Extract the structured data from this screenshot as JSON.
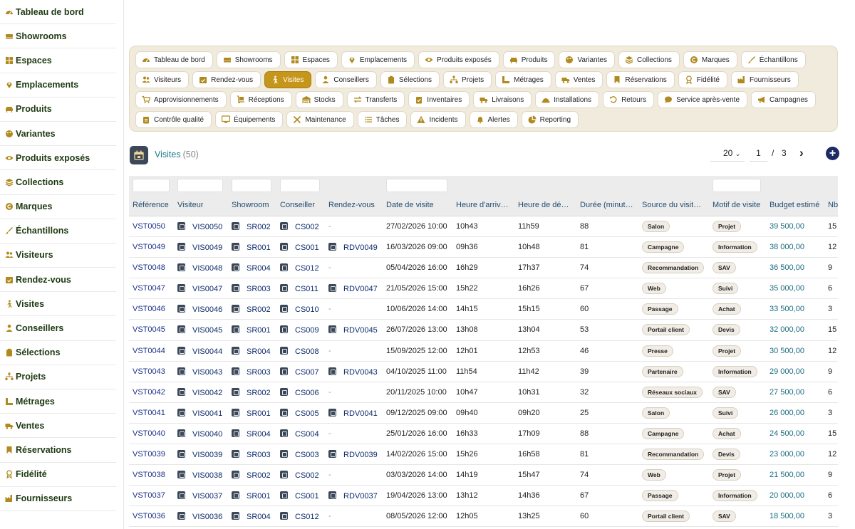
{
  "sidebar": [
    {
      "label": "Tableau de bord",
      "icon": "dashboard-icon"
    },
    {
      "label": "Showrooms",
      "icon": "showroom-icon"
    },
    {
      "label": "Espaces",
      "icon": "grid-icon"
    },
    {
      "label": "Emplacements",
      "icon": "location-pin-icon"
    },
    {
      "label": "Produits",
      "icon": "couch-icon"
    },
    {
      "label": "Variantes",
      "icon": "palette-icon"
    },
    {
      "label": "Produits exposés",
      "icon": "eye-icon"
    },
    {
      "label": "Collections",
      "icon": "layers-icon"
    },
    {
      "label": "Marques",
      "icon": "copyright-icon"
    },
    {
      "label": "Échantillons",
      "icon": "brush-icon"
    },
    {
      "label": "Visiteurs",
      "icon": "users-icon"
    },
    {
      "label": "Rendez-vous",
      "icon": "calendar-check-icon"
    },
    {
      "label": "Visites",
      "icon": "walking-icon"
    },
    {
      "label": "Conseillers",
      "icon": "user-tie-icon"
    },
    {
      "label": "Sélections",
      "icon": "clipboard-icon"
    },
    {
      "label": "Projets",
      "icon": "sitemap-icon"
    },
    {
      "label": "Métrages",
      "icon": "ruler-icon"
    },
    {
      "label": "Ventes",
      "icon": "truck-icon"
    },
    {
      "label": "Réservations",
      "icon": "bookmark-icon"
    },
    {
      "label": "Fidélité",
      "icon": "award-icon"
    },
    {
      "label": "Fournisseurs",
      "icon": "factory-icon"
    }
  ],
  "chips": [
    {
      "label": "Tableau de bord",
      "icon": "dashboard-icon",
      "active": false
    },
    {
      "label": "Showrooms",
      "icon": "showroom-icon",
      "active": false
    },
    {
      "label": "Espaces",
      "icon": "grid-icon",
      "active": false
    },
    {
      "label": "Emplacements",
      "icon": "location-pin-icon",
      "active": false
    },
    {
      "label": "Produits exposés",
      "icon": "eye-icon",
      "active": false
    },
    {
      "label": "Produits",
      "icon": "couch-icon",
      "active": false
    },
    {
      "label": "Variantes",
      "icon": "palette-icon",
      "active": false
    },
    {
      "label": "Collections",
      "icon": "layers-icon",
      "active": false
    },
    {
      "label": "Marques",
      "icon": "copyright-icon",
      "active": false
    },
    {
      "label": "Échantillons",
      "icon": "brush-icon",
      "active": false
    },
    {
      "label": "Visiteurs",
      "icon": "users-icon",
      "active": false
    },
    {
      "label": "Rendez-vous",
      "icon": "calendar-check-icon",
      "active": false
    },
    {
      "label": "Visites",
      "icon": "walking-icon",
      "active": true
    },
    {
      "label": "Conseillers",
      "icon": "user-tie-icon",
      "active": false
    },
    {
      "label": "Sélections",
      "icon": "clipboard-icon",
      "active": false
    },
    {
      "label": "Projets",
      "icon": "sitemap-icon",
      "active": false
    },
    {
      "label": "Métrages",
      "icon": "ruler-icon",
      "active": false
    },
    {
      "label": "Ventes",
      "icon": "truck-icon",
      "active": false
    },
    {
      "label": "Réservations",
      "icon": "bookmark-icon",
      "active": false
    },
    {
      "label": "Fidélité",
      "icon": "award-icon",
      "active": false
    },
    {
      "label": "Fournisseurs",
      "icon": "factory-icon",
      "active": false
    },
    {
      "label": "Approvisionnements",
      "icon": "cart-icon",
      "active": false
    },
    {
      "label": "Réceptions",
      "icon": "dolly-icon",
      "active": false
    },
    {
      "label": "Stocks",
      "icon": "warehouse-icon",
      "active": false
    },
    {
      "label": "Transferts",
      "icon": "exchange-icon",
      "active": false
    },
    {
      "label": "Inventaires",
      "icon": "clipboard-check-icon",
      "active": false
    },
    {
      "label": "Livraisons",
      "icon": "shipping-icon",
      "active": false
    },
    {
      "label": "Installations",
      "icon": "hardhat-icon",
      "active": false
    },
    {
      "label": "Retours",
      "icon": "undo-icon",
      "active": false
    },
    {
      "label": "Service après-vente",
      "icon": "comment-icon",
      "active": false
    },
    {
      "label": "Campagnes",
      "icon": "megaphone-icon",
      "active": false
    },
    {
      "label": "Contrôle qualité",
      "icon": "clipboard-list-icon",
      "active": false
    },
    {
      "label": "Équipements",
      "icon": "desktop-icon",
      "active": false
    },
    {
      "label": "Maintenance",
      "icon": "tools-icon",
      "active": false
    },
    {
      "label": "Tâches",
      "icon": "list-icon",
      "active": false
    },
    {
      "label": "Incidents",
      "icon": "warning-icon",
      "active": false
    },
    {
      "label": "Alertes",
      "icon": "bell-icon",
      "active": false
    },
    {
      "label": "Reporting",
      "icon": "pie-chart-icon",
      "active": false
    }
  ],
  "header": {
    "title": "Visites",
    "count": "(50)"
  },
  "pagination": {
    "page_size": "20",
    "page": "1",
    "separator": "/",
    "total_pages": "3"
  },
  "columns": [
    "Référence",
    "Visiteur",
    "Showroom",
    "Conseiller",
    "Rendez-vous",
    "Date de visite",
    "Heure d'arriv…",
    "Heure de dé…",
    "Durée (minut…",
    "Source du visit…",
    "Motif de visite",
    "Budget estimé",
    "Nb"
  ],
  "rows": [
    {
      "ref": "VST0050",
      "visiteur": "VIS0050",
      "showroom": "SR002",
      "conseiller": "CS002",
      "rdv": "-",
      "date": "27/02/2026 10:00",
      "arrivee": "10h43",
      "depart": "11h59",
      "duree": "88",
      "source": "Salon",
      "motif": "Projet",
      "budget": "39 500,00",
      "nb": "15"
    },
    {
      "ref": "VST0049",
      "visiteur": "VIS0049",
      "showroom": "SR001",
      "conseiller": "CS001",
      "rdv": "RDV0049",
      "date": "16/03/2026 09:00",
      "arrivee": "09h36",
      "depart": "10h48",
      "duree": "81",
      "source": "Campagne",
      "motif": "Information",
      "budget": "38 000,00",
      "nb": "12"
    },
    {
      "ref": "VST0048",
      "visiteur": "VIS0048",
      "showroom": "SR004",
      "conseiller": "CS012",
      "rdv": "-",
      "date": "05/04/2026 16:00",
      "arrivee": "16h29",
      "depart": "17h37",
      "duree": "74",
      "source": "Recommandation",
      "motif": "SAV",
      "budget": "36 500,00",
      "nb": "9"
    },
    {
      "ref": "VST0047",
      "visiteur": "VIS0047",
      "showroom": "SR003",
      "conseiller": "CS011",
      "rdv": "RDV0047",
      "date": "21/05/2026 15:00",
      "arrivee": "15h22",
      "depart": "16h26",
      "duree": "67",
      "source": "Web",
      "motif": "Suivi",
      "budget": "35 000,00",
      "nb": "6"
    },
    {
      "ref": "VST0046",
      "visiteur": "VIS0046",
      "showroom": "SR002",
      "conseiller": "CS010",
      "rdv": "-",
      "date": "10/06/2026 14:00",
      "arrivee": "14h15",
      "depart": "15h15",
      "duree": "60",
      "source": "Passage",
      "motif": "Achat",
      "budget": "33 500,00",
      "nb": "3"
    },
    {
      "ref": "VST0045",
      "visiteur": "VIS0045",
      "showroom": "SR001",
      "conseiller": "CS009",
      "rdv": "RDV0045",
      "date": "26/07/2026 13:00",
      "arrivee": "13h08",
      "depart": "13h04",
      "duree": "53",
      "source": "Portail client",
      "motif": "Devis",
      "budget": "32 000,00",
      "nb": "15"
    },
    {
      "ref": "VST0044",
      "visiteur": "VIS0044",
      "showroom": "SR004",
      "conseiller": "CS008",
      "rdv": "-",
      "date": "15/09/2025 12:00",
      "arrivee": "12h01",
      "depart": "12h53",
      "duree": "46",
      "source": "Presse",
      "motif": "Projet",
      "budget": "30 500,00",
      "nb": "12"
    },
    {
      "ref": "VST0043",
      "visiteur": "VIS0043",
      "showroom": "SR003",
      "conseiller": "CS007",
      "rdv": "RDV0043",
      "date": "04/10/2025 11:00",
      "arrivee": "11h54",
      "depart": "11h42",
      "duree": "39",
      "source": "Partenaire",
      "motif": "Information",
      "budget": "29 000,00",
      "nb": "9"
    },
    {
      "ref": "VST0042",
      "visiteur": "VIS0042",
      "showroom": "SR002",
      "conseiller": "CS006",
      "rdv": "-",
      "date": "20/11/2025 10:00",
      "arrivee": "10h47",
      "depart": "10h31",
      "duree": "32",
      "source": "Réseaux sociaux",
      "motif": "SAV",
      "budget": "27 500,00",
      "nb": "6"
    },
    {
      "ref": "VST0041",
      "visiteur": "VIS0041",
      "showroom": "SR001",
      "conseiller": "CS005",
      "rdv": "RDV0041",
      "date": "09/12/2025 09:00",
      "arrivee": "09h40",
      "depart": "09h20",
      "duree": "25",
      "source": "Salon",
      "motif": "Suivi",
      "budget": "26 000,00",
      "nb": "3"
    },
    {
      "ref": "VST0040",
      "visiteur": "VIS0040",
      "showroom": "SR004",
      "conseiller": "CS004",
      "rdv": "-",
      "date": "25/01/2026 16:00",
      "arrivee": "16h33",
      "depart": "17h09",
      "duree": "88",
      "source": "Campagne",
      "motif": "Achat",
      "budget": "24 500,00",
      "nb": "15"
    },
    {
      "ref": "VST0039",
      "visiteur": "VIS0039",
      "showroom": "SR003",
      "conseiller": "CS003",
      "rdv": "RDV0039",
      "date": "14/02/2026 15:00",
      "arrivee": "15h26",
      "depart": "16h58",
      "duree": "81",
      "source": "Recommandation",
      "motif": "Devis",
      "budget": "23 000,00",
      "nb": "12"
    },
    {
      "ref": "VST0038",
      "visiteur": "VIS0038",
      "showroom": "SR002",
      "conseiller": "CS002",
      "rdv": "-",
      "date": "03/03/2026 14:00",
      "arrivee": "14h19",
      "depart": "15h47",
      "duree": "74",
      "source": "Web",
      "motif": "Projet",
      "budget": "21 500,00",
      "nb": "9"
    },
    {
      "ref": "VST0037",
      "visiteur": "VIS0037",
      "showroom": "SR001",
      "conseiller": "CS001",
      "rdv": "RDV0037",
      "date": "19/04/2026 13:00",
      "arrivee": "13h12",
      "depart": "14h36",
      "duree": "67",
      "source": "Passage",
      "motif": "Information",
      "budget": "20 000,00",
      "nb": "6"
    },
    {
      "ref": "VST0036",
      "visiteur": "VIS0036",
      "showroom": "SR004",
      "conseiller": "CS012",
      "rdv": "-",
      "date": "08/05/2026 12:00",
      "arrivee": "12h05",
      "depart": "13h25",
      "duree": "60",
      "source": "Portail client",
      "motif": "SAV",
      "budget": "18 500,00",
      "nb": "3"
    }
  ],
  "colors": {
    "accent": "#c5961a",
    "sidebar_text": "#1f3a12",
    "icon_gold": "#b08a1e",
    "chip_panel": "#f1ebdd",
    "link": "#0c2a6b",
    "add_button": "#1d2b64"
  }
}
